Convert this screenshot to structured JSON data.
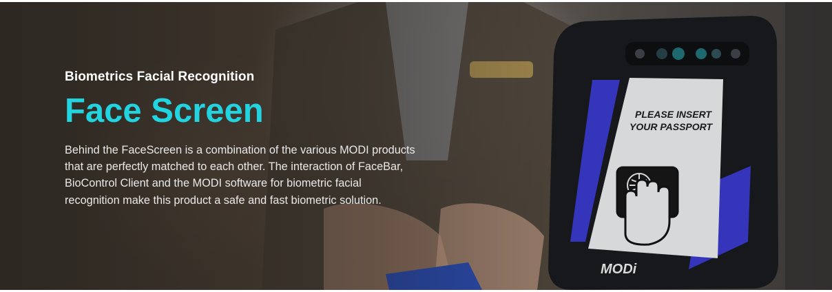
{
  "hero": {
    "eyebrow": "Biometrics Facial Recognition",
    "title": "Face Screen",
    "description": "Behind the FaceScreen is a combination of the various MODI products that are perfectly matched to each other. The interaction of FaceBar, BioControl Client and the MODI software for biometric facial recognition make this product a safe and fast biometric solution.",
    "accent_color": "#22d3e0"
  },
  "device": {
    "screen_line_1": "PLEASE INSERT",
    "screen_line_2": "YOUR PASSPORT",
    "brand": "MODi",
    "icon": "passport-hand-icon"
  }
}
